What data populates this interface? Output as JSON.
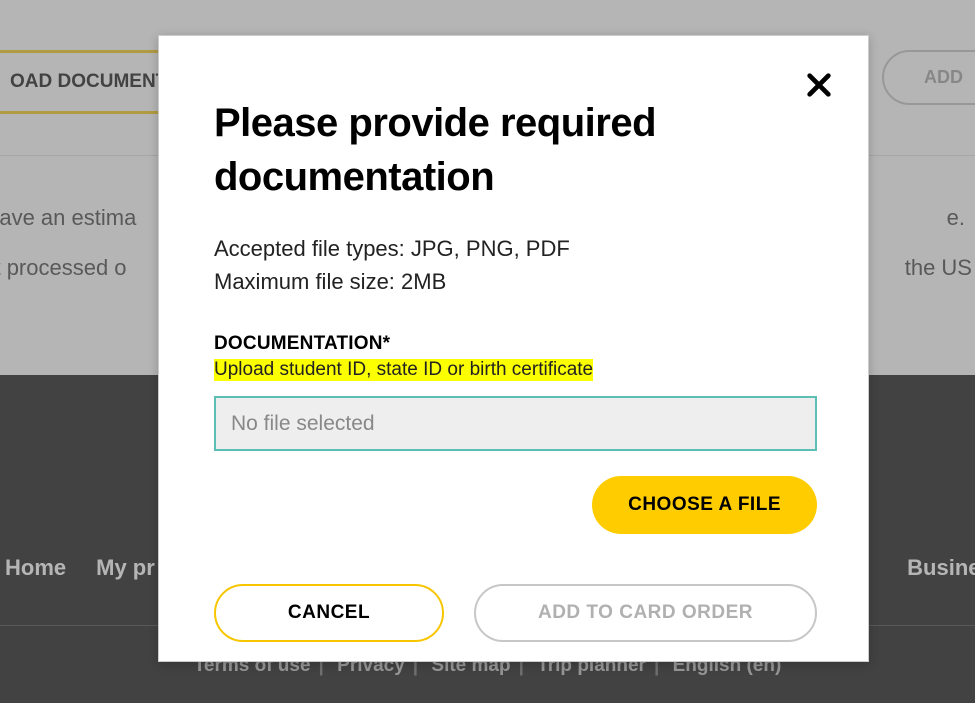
{
  "background": {
    "tab_label": "OAD DOCUMENTS",
    "add_button": "ADD",
    "line1": "s have an estima",
    "line1_right": "e.",
    "line2_left": "not processed o",
    "line2_right": "the US Po",
    "footer_nav": {
      "home": "Home",
      "my_pr": "My pr",
      "business": "Business"
    },
    "footer_links": {
      "terms": "Terms of use",
      "privacy": "Privacy",
      "sitemap": "Site map",
      "trip": "Trip planner",
      "english": "English (en)"
    }
  },
  "modal": {
    "title": "Please provide required documentation",
    "accepted": "Accepted file types: JPG, PNG, PDF",
    "maxsize": "Maximum file size: 2MB",
    "doc_label": "DOCUMENTATION*",
    "upload_hint": "Upload student ID, state ID or birth certificate",
    "file_placeholder": "No file selected",
    "choose_label": "CHOOSE A FILE",
    "cancel_label": "CANCEL",
    "add_order_label": "ADD TO CARD ORDER"
  }
}
